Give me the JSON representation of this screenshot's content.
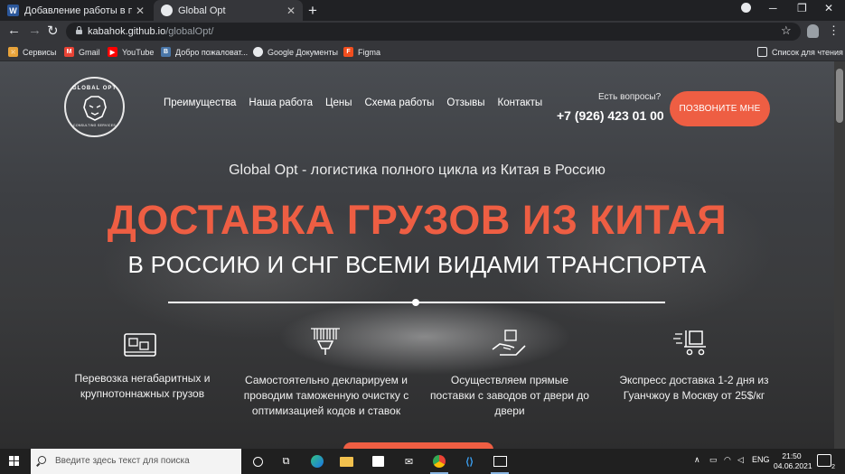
{
  "browser": {
    "tabs": [
      {
        "title": "Добавление работы в портфол",
        "favicon": "word-icon",
        "active": false
      },
      {
        "title": "Global Opt",
        "favicon": "globe-icon",
        "active": true
      }
    ],
    "url_host": "kabahok.github.io",
    "url_path": "/globalOpt/",
    "bookmarks": [
      {
        "label": "Сервисы",
        "icon": "apps-grid-icon",
        "color": "#e8a33a"
      },
      {
        "label": "Gmail",
        "icon": "gmail-icon",
        "color": "#ea4335"
      },
      {
        "label": "YouTube",
        "icon": "youtube-icon",
        "color": "#ff0000"
      },
      {
        "label": "Добро пожаловат...",
        "icon": "vk-icon",
        "color": "#4a76a8"
      },
      {
        "label": "Google Документы",
        "icon": "globe-icon",
        "color": "#e8eaed"
      },
      {
        "label": "Figma",
        "icon": "figma-icon",
        "color": "#f24e1e"
      }
    ],
    "reading_list": "Список для чтения"
  },
  "site": {
    "logo": {
      "top": "GLOBAL OPT",
      "bottom": "CONSULTING SERVICES"
    },
    "nav": [
      "Преимущества",
      "Наша работа",
      "Цены",
      "Схема работы",
      "Отзывы",
      "Контакты"
    ],
    "question": "Есть вопросы?",
    "phone": "+7 (926) 423 01 00",
    "call_button": "ПОЗВОНИТЕ МНЕ",
    "subtitle": "Global Opt - логистика полного цикла из Китая в Россию",
    "headline": "ДОСТАВКА ГРУЗОВ ИЗ КИТАЯ",
    "headline2": "В РОССИЮ И СНГ ВСЕМИ ВИДАМИ ТРАНСПОРТА",
    "features": [
      {
        "icon": "container-icon",
        "text": "Перевозка негабаритных и крупнотоннажных грузов"
      },
      {
        "icon": "barcode-scanner-icon",
        "text": "Самостоятельно декларируем и проводим таможенную очистку с оптимизацией кодов и ставок"
      },
      {
        "icon": "hand-box-icon",
        "text": "Осуществляем прямые поставки с заводов от двери до двери"
      },
      {
        "icon": "express-cart-icon",
        "text": "Экспресс доставка 1-2 дня из Гуанчжоу в Москву от 25$/кг"
      }
    ],
    "accent_color": "#ee5e43"
  },
  "taskbar": {
    "search_placeholder": "Введите здесь текст для поиска",
    "language": "ENG",
    "time": "21:50",
    "date": "04.06.2021",
    "notifications": "2"
  }
}
